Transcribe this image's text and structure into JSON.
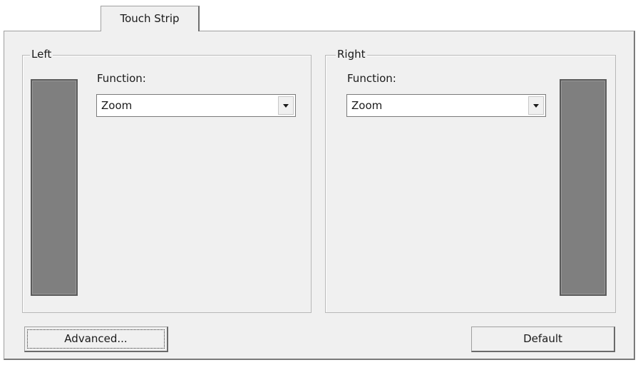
{
  "tabs": [
    {
      "label": "Touch Strip",
      "selected": true
    }
  ],
  "left_group": {
    "legend": "Left",
    "function_label": "Function:",
    "function_value": "Zoom"
  },
  "right_group": {
    "legend": "Right",
    "function_label": "Function:",
    "function_value": "Zoom"
  },
  "buttons": {
    "advanced_label": "Advanced...",
    "default_label": "Default"
  },
  "colors": {
    "panel_background": "#f0f0f0",
    "strip_fill": "#7f7f7f"
  },
  "icons": {
    "dropdown": "chevron-down-icon"
  }
}
